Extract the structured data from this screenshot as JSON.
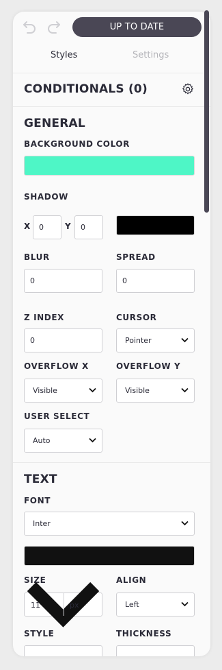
{
  "header": {
    "status": "UP TO DATE",
    "undo_icon": "undo-icon",
    "redo_icon": "redo-icon"
  },
  "tabs": [
    {
      "label": "Styles",
      "active": true
    },
    {
      "label": "Settings",
      "active": false
    }
  ],
  "conditionals": {
    "title": "CONDITIONALS (0)",
    "icon": "gear-icon"
  },
  "general": {
    "title": "GENERAL",
    "background_label": "BACKGROUND COLOR",
    "background_color": "#4ef6c6",
    "shadow_label": "SHADOW",
    "x_label": "X",
    "x_value": "0",
    "y_label": "Y",
    "y_value": "0",
    "shadow_color": "#000000",
    "blur_label": "BLUR",
    "blur_value": "0",
    "spread_label": "SPREAD",
    "spread_value": "0",
    "zindex_label": "Z INDEX",
    "zindex_value": "0",
    "cursor_label": "CURSOR",
    "cursor_value": "Pointer",
    "overflowx_label": "OVERFLOW X",
    "overflowx_value": "Visible",
    "overflowy_label": "OVERFLOW Y",
    "overflowy_value": "Visible",
    "userselect_label": "USER SELECT",
    "userselect_value": "Auto"
  },
  "text": {
    "title": "TEXT",
    "font_label": "FONT",
    "font_value": "Inter",
    "font_color": "#111111",
    "size_label": "SIZE",
    "size_value": "11",
    "size_unit": "px",
    "align_label": "ALIGN",
    "align_value": "Left",
    "style_label": "STYLE",
    "thickness_label": "THICKNESS"
  },
  "colors": {
    "accent": "#4a4755",
    "text": "#2b2b38",
    "muted": "#b3b3b8"
  }
}
